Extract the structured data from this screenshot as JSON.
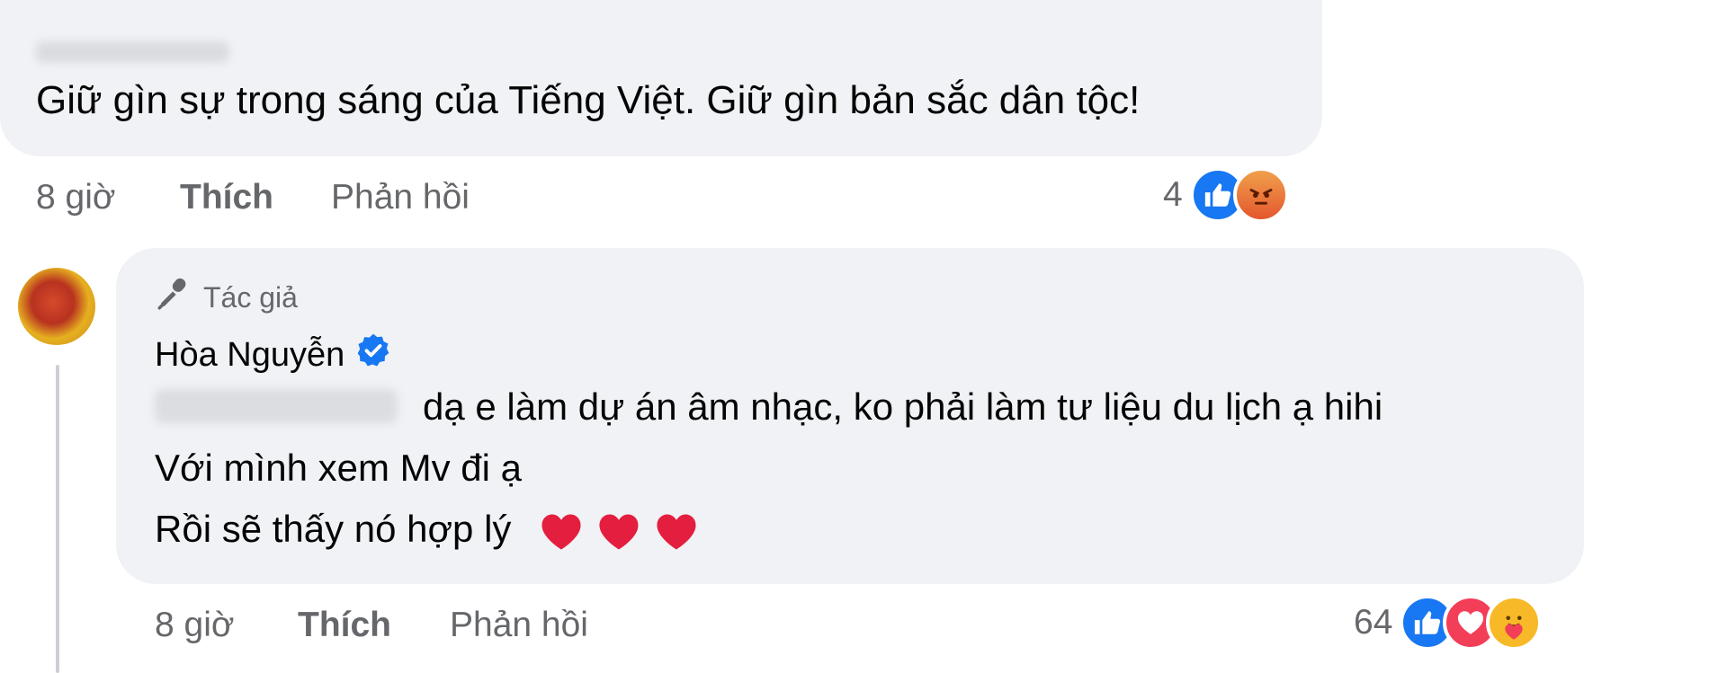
{
  "comments": [
    {
      "text": "Giữ gìn sự trong sáng của Tiếng Việt. Giữ gìn bản sắc dân tộc!",
      "time": "8 giờ",
      "like_label": "Thích",
      "reply_label": "Phản hồi",
      "reaction_count": "4",
      "reactions": [
        "like",
        "angry"
      ]
    },
    {
      "badge": "Tác giả",
      "author": "Hòa Nguyễn",
      "lines": [
        "dạ e làm dự án âm nhạc, ko phải làm tư liệu du lịch ạ hihi",
        "Với mình xem Mv đi ạ",
        "Rồi sẽ thấy nó hợp lý"
      ],
      "time": "8 giờ",
      "like_label": "Thích",
      "reply_label": "Phản hồi",
      "reaction_count": "64",
      "reactions": [
        "like",
        "love",
        "care"
      ]
    }
  ],
  "colors": {
    "bubble": "#f0f2f5",
    "meta_text": "#65676b",
    "like_blue": "#1877f2",
    "heart_red": "#e41e3f",
    "verified_blue": "#1877f2"
  }
}
